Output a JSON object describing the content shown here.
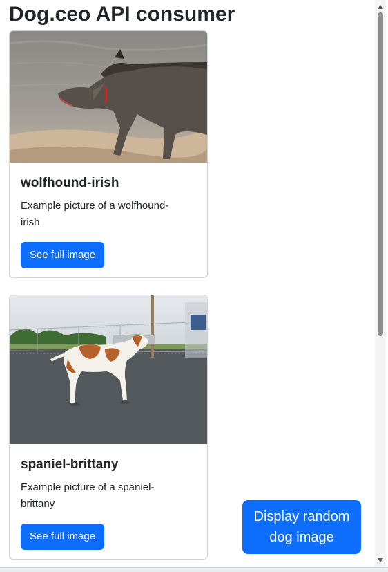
{
  "page": {
    "title": "Dog.ceo API consumer"
  },
  "cards": [
    {
      "title": "wolfhound-irish",
      "text": "Example picture of a wolfhound-irish",
      "button_label": "See full image",
      "image_alt": "wolfhound-irish"
    },
    {
      "title": "spaniel-brittany",
      "text": "Example picture of a spaniel-brittany",
      "button_label": "See full image",
      "image_alt": "spaniel-brittany"
    }
  ],
  "random_button": {
    "label": "Display random dog image"
  },
  "colors": {
    "primary": "#0d6efd",
    "text": "#212529",
    "card_border": "#cfd4da",
    "scroll_thumb": "#8c8c8c"
  },
  "icons": {
    "scroll_up": "scroll-up-arrow-icon",
    "scroll_down": "scroll-down-arrow-icon"
  }
}
